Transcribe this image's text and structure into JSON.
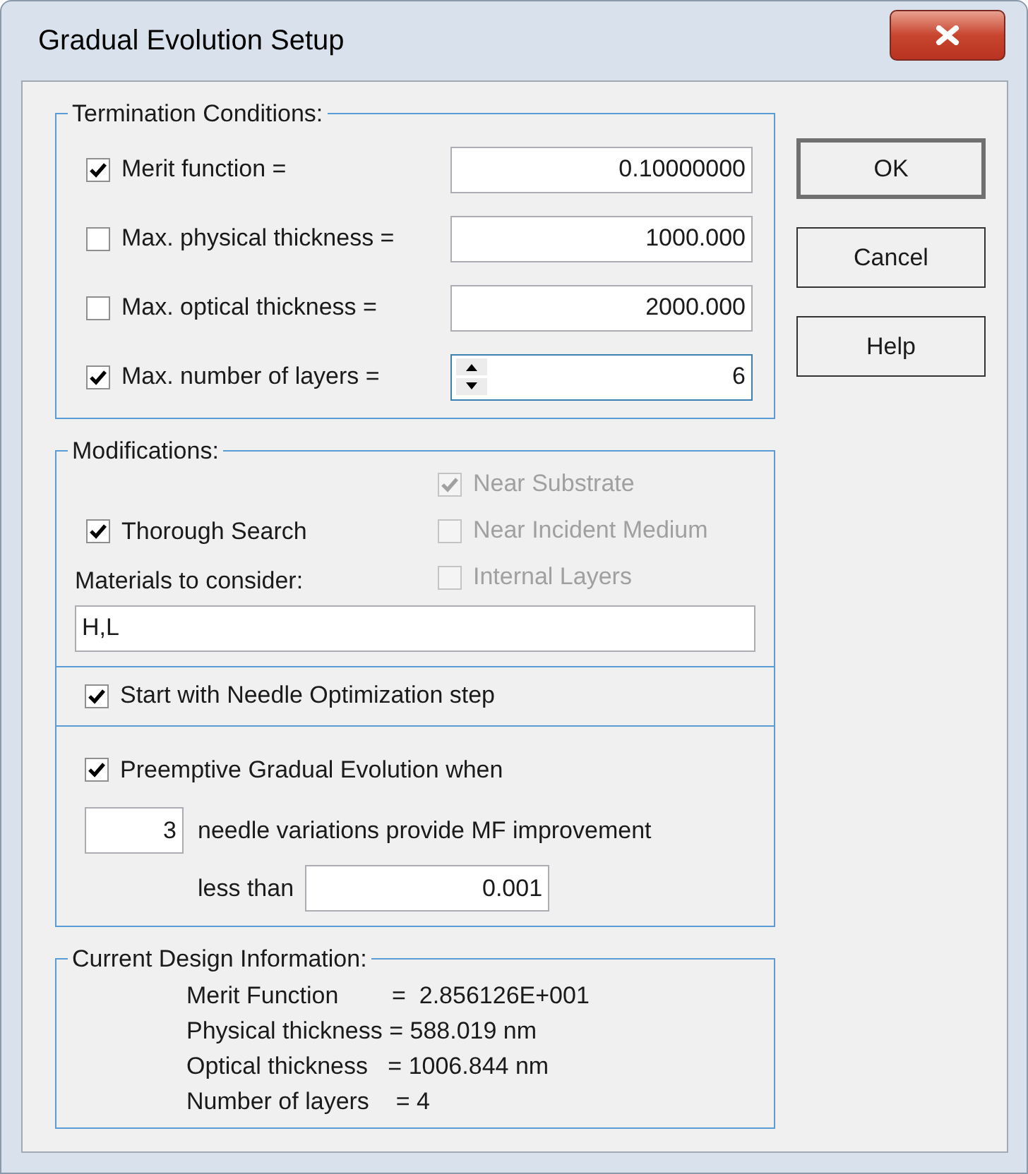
{
  "window": {
    "title": "Gradual Evolution Setup"
  },
  "termination": {
    "title": "Termination Conditions:",
    "rows": [
      {
        "kind": "text",
        "label": "Merit function =",
        "checked": true,
        "value": "0.10000000"
      },
      {
        "kind": "text",
        "label": "Max. physical thickness =",
        "checked": false,
        "value": "1000.000"
      },
      {
        "kind": "text",
        "label": "Max. optical thickness =",
        "checked": false,
        "value": "2000.000"
      },
      {
        "kind": "spin",
        "label": "Max. number of layers =",
        "checked": true,
        "value": "6"
      }
    ]
  },
  "modifications": {
    "title": "Modifications:",
    "thorough_search": {
      "label": "Thorough Search",
      "checked": true
    },
    "options": [
      {
        "label": "Near Substrate",
        "checked": true,
        "disabled": true
      },
      {
        "label": "Near Incident Medium",
        "checked": false,
        "disabled": true
      },
      {
        "label": "Internal Layers",
        "checked": false,
        "disabled": true
      }
    ],
    "materials_label": "Materials to consider:",
    "materials_value": "H,L"
  },
  "needle_step": {
    "label": "Start with Needle Optimization step",
    "checked": true
  },
  "preemptive": {
    "label": "Preemptive Gradual Evolution when",
    "checked": true,
    "count": "3",
    "count_text": "needle variations provide MF improvement",
    "less_than_label": "less than",
    "less_than_value": "0.001"
  },
  "current_design": {
    "title": "Current Design Information:",
    "lines": [
      "Merit Function        =  2.856126E+001",
      "Physical thickness = 588.019 nm",
      "Optical thickness   = 1006.844 nm",
      "Number of layers    = 4"
    ]
  },
  "buttons": [
    {
      "label": "OK",
      "default": true
    },
    {
      "label": "Cancel",
      "default": false
    },
    {
      "label": "Help",
      "default": false
    }
  ]
}
